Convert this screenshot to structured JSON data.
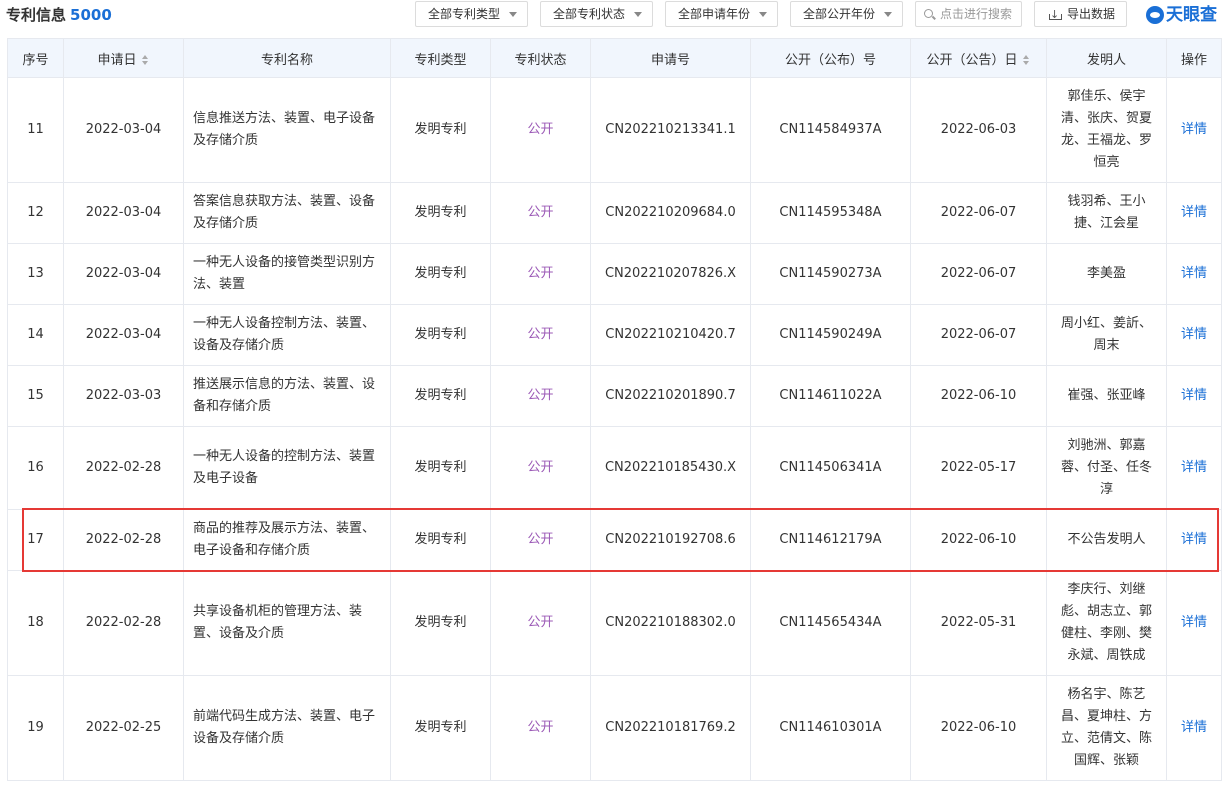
{
  "header": {
    "title": "专利信息",
    "count": "5000",
    "filters": [
      "全部专利类型",
      "全部专利状态",
      "全部申请年份",
      "全部公开年份"
    ],
    "search_placeholder": "点击进行搜索",
    "export_label": "导出数据",
    "brand": "天眼查"
  },
  "table": {
    "columns": [
      "序号",
      "申请日",
      "专利名称",
      "专利类型",
      "专利状态",
      "申请号",
      "公开（公布）号",
      "公开（公告）日",
      "发明人",
      "操作"
    ],
    "rows": [
      {
        "index": "11",
        "apply_date": "2022-03-04",
        "name": "信息推送方法、装置、电子设备及存储介质",
        "type": "发明专利",
        "status": "公开",
        "apply_no": "CN202210213341.1",
        "pub_no": "CN114584937A",
        "pub_date": "2022-06-03",
        "inventor": "郭佳乐、侯宇清、张庆、贺夏龙、王福龙、罗恒亮",
        "op": "详情"
      },
      {
        "index": "12",
        "apply_date": "2022-03-04",
        "name": "答案信息获取方法、装置、设备及存储介质",
        "type": "发明专利",
        "status": "公开",
        "apply_no": "CN202210209684.0",
        "pub_no": "CN114595348A",
        "pub_date": "2022-06-07",
        "inventor": "钱羽希、王小捷、江会星",
        "op": "详情"
      },
      {
        "index": "13",
        "apply_date": "2022-03-04",
        "name": "一种无人设备的接管类型识别方法、装置",
        "type": "发明专利",
        "status": "公开",
        "apply_no": "CN202210207826.X",
        "pub_no": "CN114590273A",
        "pub_date": "2022-06-07",
        "inventor": "李美盈",
        "op": "详情"
      },
      {
        "index": "14",
        "apply_date": "2022-03-04",
        "name": "一种无人设备控制方法、装置、设备及存储介质",
        "type": "发明专利",
        "status": "公开",
        "apply_no": "CN202210210420.7",
        "pub_no": "CN114590249A",
        "pub_date": "2022-06-07",
        "inventor": "周小红、姜訢、周末",
        "op": "详情"
      },
      {
        "index": "15",
        "apply_date": "2022-03-03",
        "name": "推送展示信息的方法、装置、设备和存储介质",
        "type": "发明专利",
        "status": "公开",
        "apply_no": "CN202210201890.7",
        "pub_no": "CN114611022A",
        "pub_date": "2022-06-10",
        "inventor": "崔强、张亚峰",
        "op": "详情"
      },
      {
        "index": "16",
        "apply_date": "2022-02-28",
        "name": "一种无人设备的控制方法、装置及电子设备",
        "type": "发明专利",
        "status": "公开",
        "apply_no": "CN202210185430.X",
        "pub_no": "CN114506341A",
        "pub_date": "2022-05-17",
        "inventor": "刘驰洲、郭嘉蓉、付圣、任冬淳",
        "op": "详情"
      },
      {
        "index": "17",
        "apply_date": "2022-02-28",
        "name": "商品的推荐及展示方法、装置、电子设备和存储介质",
        "type": "发明专利",
        "status": "公开",
        "apply_no": "CN202210192708.6",
        "pub_no": "CN114612179A",
        "pub_date": "2022-06-10",
        "inventor": "不公告发明人",
        "op": "详情"
      },
      {
        "index": "18",
        "apply_date": "2022-02-28",
        "name": "共享设备机柜的管理方法、装置、设备及介质",
        "type": "发明专利",
        "status": "公开",
        "apply_no": "CN202210188302.0",
        "pub_no": "CN114565434A",
        "pub_date": "2022-05-31",
        "inventor": "李庆行、刘继彪、胡志立、郭健柱、李刚、樊永斌、周铁成",
        "op": "详情"
      },
      {
        "index": "19",
        "apply_date": "2022-02-25",
        "name": "前端代码生成方法、装置、电子设备及存储介质",
        "type": "发明专利",
        "status": "公开",
        "apply_no": "CN202210181769.2",
        "pub_no": "CN114610301A",
        "pub_date": "2022-06-10",
        "inventor": "杨名宇、陈艺昌、夏坤柱、方立、范倩文、陈国辉、张颖",
        "op": "详情"
      }
    ]
  }
}
